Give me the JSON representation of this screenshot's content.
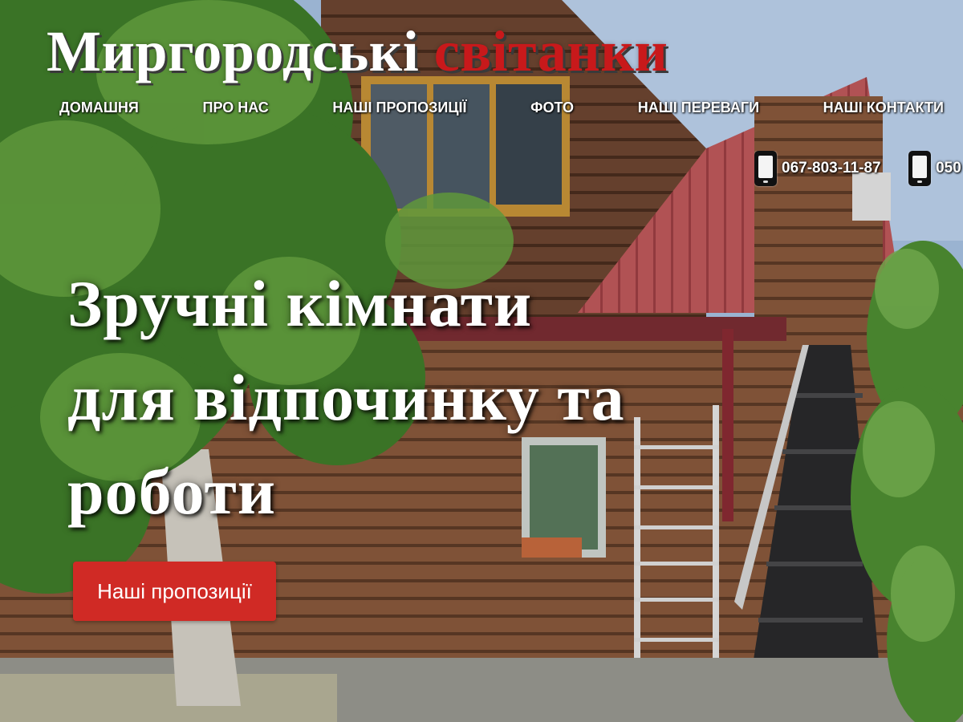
{
  "header": {
    "logo_part1": "Миргородські",
    "logo_part2": "світанки",
    "logo_part2_color": "#c8191b"
  },
  "nav": {
    "items": [
      {
        "label": "ДОМАШНЯ"
      },
      {
        "label": "ПРО НАС"
      },
      {
        "label": "НАШІ ПРОПОЗИЦІЇ"
      },
      {
        "label": "ФОТО"
      },
      {
        "label": "НАШІ ПЕРЕВАГИ"
      },
      {
        "label": "НАШІ КОНТАКТИ"
      }
    ]
  },
  "contacts": {
    "icon": "mobile-phone-icon",
    "phones": [
      "067-803-11-87",
      "050"
    ]
  },
  "hero": {
    "title_line1": "Зручні кімнати",
    "title_line2": "для відпочинку та",
    "title_line3": "роботи",
    "cta_label": "Наші пропозиції",
    "cta_color": "#d02a25"
  }
}
